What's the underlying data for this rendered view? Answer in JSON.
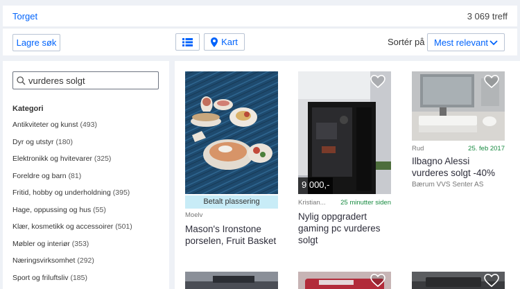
{
  "header": {
    "breadcrumb": "Torget",
    "result_count": "3 069 treff"
  },
  "toolbar": {
    "save_search": "Lagre søk",
    "list_view_icon": "list-icon",
    "map_label": "Kart",
    "sort_label": "Sortér på",
    "sort_value": "Mest relevant"
  },
  "search": {
    "value": "vurderes solgt"
  },
  "sidebar": {
    "title": "Kategori",
    "categories": [
      {
        "label": "Antikviteter og kunst",
        "count": "(493)"
      },
      {
        "label": "Dyr og utstyr",
        "count": "(180)"
      },
      {
        "label": "Elektronikk og hvitevarer",
        "count": "(325)"
      },
      {
        "label": "Foreldre og barn",
        "count": "(81)"
      },
      {
        "label": "Fritid, hobby og underholdning",
        "count": "(395)"
      },
      {
        "label": "Hage, oppussing og hus",
        "count": "(55)"
      },
      {
        "label": "Klær, kosmetikk og accessoirer",
        "count": "(501)"
      },
      {
        "label": "Møbler og interiør",
        "count": "(353)"
      },
      {
        "label": "Næringsvirksomhet",
        "count": "(292)"
      },
      {
        "label": "Sport og friluftsliv",
        "count": "(185)"
      }
    ]
  },
  "listings": [
    {
      "badge": "Betalt plassering",
      "location": "Moelv",
      "time": "",
      "title": "Mason's Ironstone porselen, Fruit Basket",
      "seller": "",
      "price": ""
    },
    {
      "badge": "",
      "location": "Kristian...",
      "time": "25 minutter siden",
      "title": "Nylig oppgradert gaming pc vurderes solgt",
      "seller": "",
      "price": "9 000,-"
    },
    {
      "badge": "",
      "location": "Rud",
      "time": "25. feb 2017",
      "title": "Ilbagno Alessi vurderes solgt -40%",
      "seller": "Bærum VVS Senter AS",
      "price": ""
    }
  ],
  "colors": {
    "link": "#0063fb",
    "paid_badge": "#c8ecf7",
    "time_green": "#178a40"
  }
}
